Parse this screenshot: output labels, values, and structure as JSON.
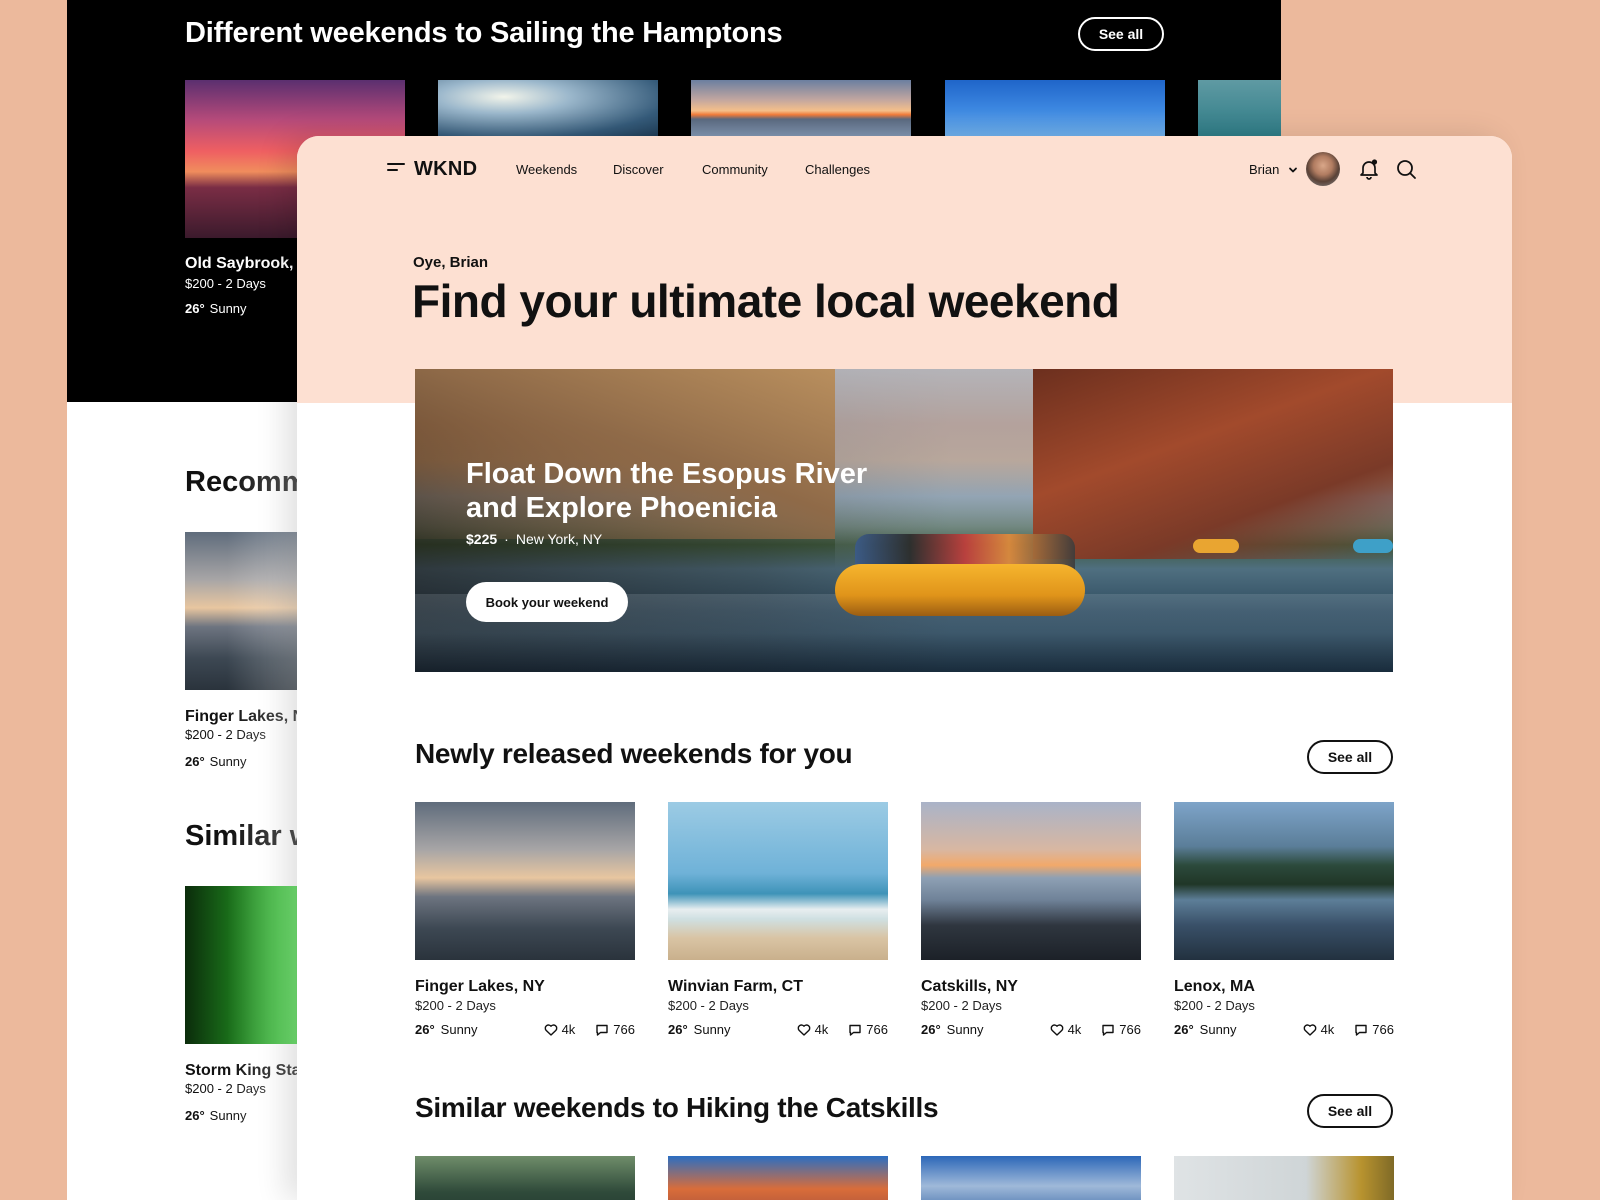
{
  "background_screen": {
    "title": "Different weekends to Sailing the Hamptons",
    "see_all": "See all",
    "card": {
      "name": "Old Saybrook,",
      "price": "$200 - 2 Days",
      "temp": "26°",
      "weather": "Sunny"
    },
    "recommended_title": "Recomm",
    "rec_card": {
      "name": "Finger Lakes, N",
      "price": "$200 - 2 Days",
      "temp": "26°",
      "weather": "Sunny"
    },
    "similar_title": "Similar w",
    "similar_card": {
      "name": "Storm King Sta",
      "price": "$200 - 2 Days",
      "temp": "26°",
      "weather": "Sunny"
    }
  },
  "nav": {
    "logo": "WKND",
    "links": [
      "Weekends",
      "Discover",
      "Community",
      "Challenges"
    ],
    "user": "Brian",
    "icons": [
      "menu-icon",
      "chevron-down-icon",
      "avatar",
      "bell-icon",
      "search-icon"
    ]
  },
  "hero": {
    "greeting": "Oye, Brian",
    "headline": "Find your ultimate local weekend",
    "feature_title": "Float Down the Esopus River and Explore Phoenicia",
    "price": "$225",
    "separator": "·",
    "location": "New York, NY",
    "cta": "Book your weekend"
  },
  "newly_released": {
    "title": "Newly released weekends for you",
    "see_all": "See all",
    "cards": [
      {
        "name": "Finger Lakes, NY",
        "price": "$200 - 2 Days",
        "temp": "26°",
        "weather": "Sunny",
        "likes": "4k",
        "comments": "766"
      },
      {
        "name": "Winvian Farm, CT",
        "price": "$200 - 2 Days",
        "temp": "26°",
        "weather": "Sunny",
        "likes": "4k",
        "comments": "766"
      },
      {
        "name": "Catskills, NY",
        "price": "$200 - 2 Days",
        "temp": "26°",
        "weather": "Sunny",
        "likes": "4k",
        "comments": "766"
      },
      {
        "name": "Lenox, MA",
        "price": "$200 - 2 Days",
        "temp": "26°",
        "weather": "Sunny",
        "likes": "4k",
        "comments": "766"
      }
    ]
  },
  "similar": {
    "title": "Similar weekends to Hiking the Catskills",
    "see_all": "See all"
  },
  "colors": {
    "page_background": "#ecb99c",
    "header_peach": "#fde0d2",
    "dark_band": "#000000",
    "text": "#111111"
  }
}
